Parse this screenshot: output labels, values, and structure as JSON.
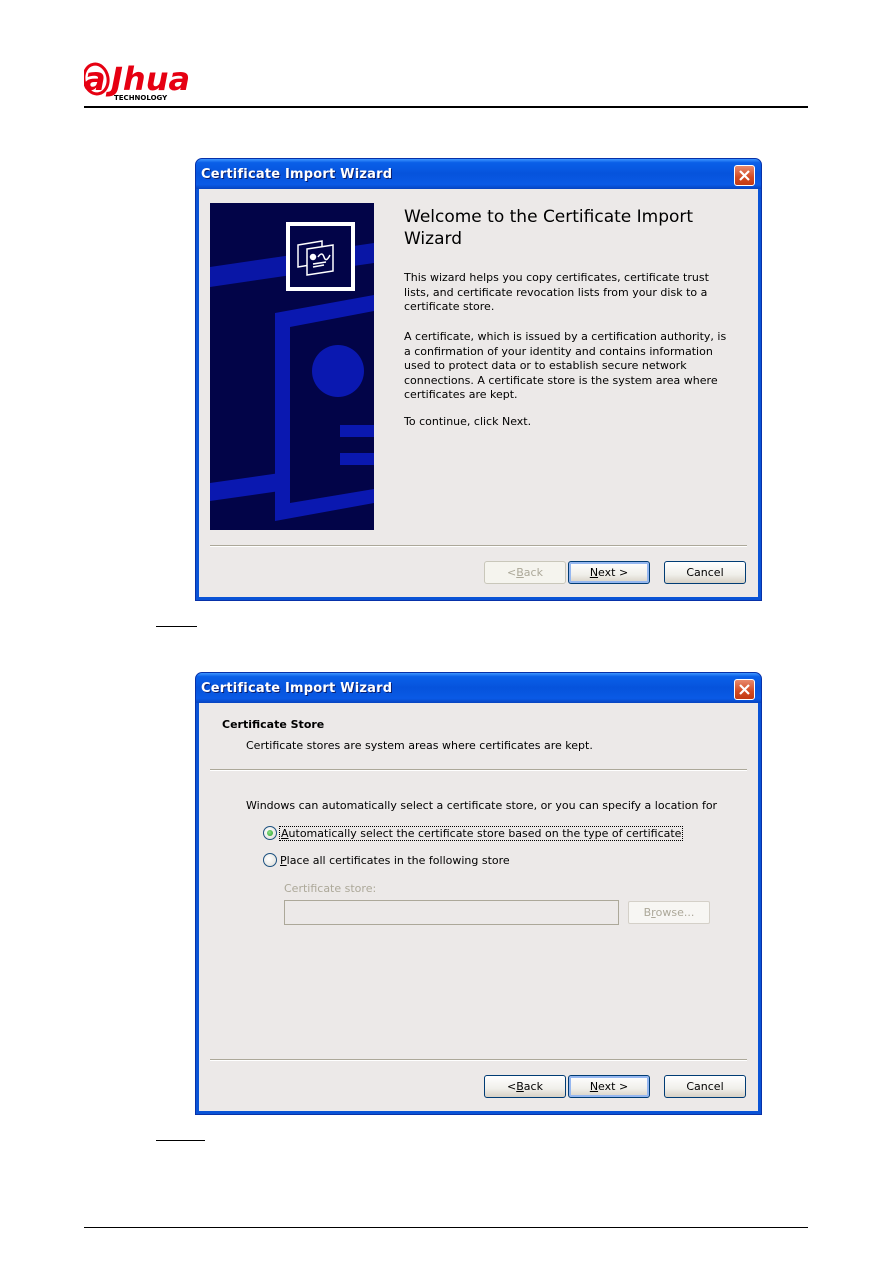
{
  "brand": {
    "name": "alhua",
    "tagline": "TECHNOLOGY",
    "color": "#e60012"
  },
  "dialogs": [
    {
      "title": "Certificate Import Wizard",
      "welcome": {
        "title": "Welcome to the Certificate Import Wizard",
        "paragraphs": [
          "This wizard helps you copy certificates, certificate trust lists, and certificate revocation lists from your disk to a certificate store.",
          "A certificate, which is issued by a certification authority, is a confirmation of your identity and contains information used to protect data or to establish secure network connections. A certificate store is the system area where certificates are kept.",
          "To continue, click Next."
        ]
      },
      "buttons": {
        "back": {
          "prefix": "< ",
          "accel": "B",
          "rest": "ack",
          "enabled": false
        },
        "next": {
          "accel": "N",
          "rest": "ext >",
          "enabled": true
        },
        "cancel": {
          "label": "Cancel",
          "enabled": true
        }
      }
    },
    {
      "title": "Certificate Import Wizard",
      "heading": "Certificate Store",
      "subheading": "Certificate stores are system areas where certificates are kept.",
      "intro": "Windows can automatically select a certificate store, or you can specify a location for",
      "options": [
        {
          "accel": "A",
          "rest": "utomatically select the certificate store based on the type of certificate",
          "selected": true
        },
        {
          "accel": "P",
          "rest": "lace all certificates in the following store",
          "selected": false
        }
      ],
      "store_label": "Certificate store:",
      "store_value": "",
      "browse": {
        "pre": "B",
        "accel": "r",
        "rest": "owse...",
        "enabled": false
      },
      "buttons": {
        "back": {
          "prefix": "< ",
          "accel": "B",
          "rest": "ack",
          "enabled": true
        },
        "next": {
          "accel": "N",
          "rest": "ext >",
          "enabled": true
        },
        "cancel": {
          "label": "Cancel",
          "enabled": true
        }
      }
    }
  ]
}
